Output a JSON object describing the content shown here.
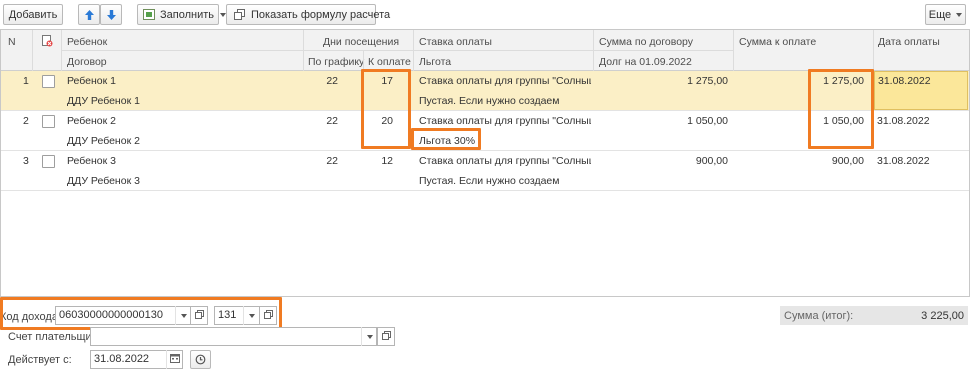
{
  "toolbar": {
    "add_label": "Добавить",
    "fill_label": "Заполнить",
    "show_formula_label": "Показать формулу расчета",
    "more_label": "Еще"
  },
  "table": {
    "headers": {
      "n": "N",
      "child": "Ребенок",
      "contract": "Договор",
      "days": "Дни посещения",
      "by_schedule": "По графику",
      "to_pay_days": "К оплате",
      "rate": "Ставка оплаты",
      "benefit": "Льгота",
      "sum_contract": "Сумма по договору",
      "debt": "Долг на 01.09.2022",
      "sum_to_pay": "Сумма к оплате",
      "pay_date": "Дата оплаты"
    },
    "rows": [
      {
        "n": "1",
        "child": "Ребенок 1",
        "contract": "ДДУ Ребенок 1",
        "by_schedule": "22",
        "to_pay": "17",
        "rate": "Ставка оплаты для группы \"Солныш...",
        "benefit": "Пустая. Если нужно создаем",
        "sum_contract": "1 275,00",
        "sum_to_pay": "1 275,00",
        "pay_date": "31.08.2022"
      },
      {
        "n": "2",
        "child": "Ребенок 2",
        "contract": "ДДУ Ребенок 2",
        "by_schedule": "22",
        "to_pay": "20",
        "rate": "Ставка оплаты для группы \"Солныш...",
        "benefit": "Льгота 30%",
        "sum_contract": "1 050,00",
        "sum_to_pay": "1 050,00",
        "pay_date": "31.08.2022"
      },
      {
        "n": "3",
        "child": "Ребенок 3",
        "contract": "ДДУ Ребенок 3",
        "by_schedule": "22",
        "to_pay": "12",
        "rate": "Ставка оплаты для группы \"Солныш...",
        "benefit": "Пустая. Если нужно создаем",
        "sum_contract": "900,00",
        "sum_to_pay": "900,00",
        "pay_date": "31.08.2022"
      }
    ]
  },
  "footer": {
    "income_code_label": "Код дохода:",
    "income_code_value": "06030000000000130",
    "income_code_extra": "131",
    "payer_account_label": "Счет плательщика:",
    "payer_account_value": "",
    "valid_from_label": "Действует с:",
    "valid_from_value": "31.08.2022",
    "total_label": "Сумма (итог):",
    "total_value": "3 225,00"
  },
  "colors": {
    "highlight": "#f07b22",
    "selected_row": "#fbefc6",
    "arrow_blue": "#2a7ad6"
  },
  "icons": [
    "arrow-up-icon",
    "arrow-down-icon",
    "fill-icon",
    "copy-icon",
    "delete-mark-icon",
    "calendar-icon",
    "history-icon",
    "open-icon"
  ]
}
